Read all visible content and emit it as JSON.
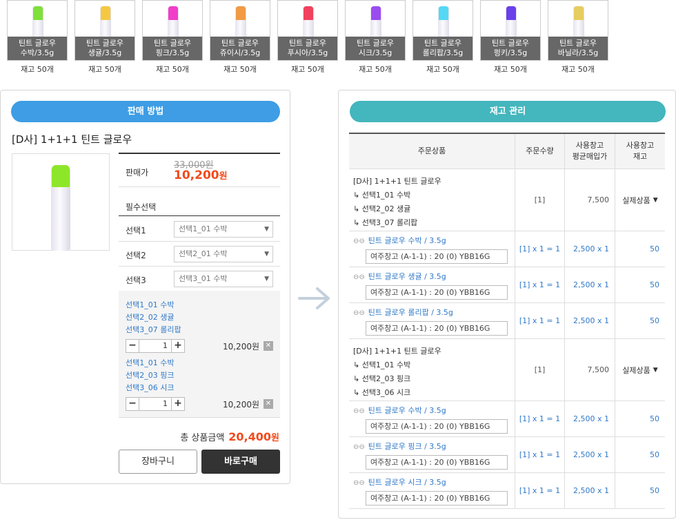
{
  "thumbs": [
    {
      "line1": "틴트 글로우",
      "line2": "수박/3.5g",
      "stock": "재고 50개",
      "cap": "#7fe03a"
    },
    {
      "line1": "틴트 글로우",
      "line2": "생귤/3.5g",
      "stock": "재고 50개",
      "cap": "#f5c842"
    },
    {
      "line1": "틴트 글로우",
      "line2": "핑크/3.5g",
      "stock": "재고 50개",
      "cap": "#f03ec9"
    },
    {
      "line1": "틴트 글로우",
      "line2": "쥬이시/3.5g",
      "stock": "재고 50개",
      "cap": "#f29a46"
    },
    {
      "line1": "틴트 글로우",
      "line2": "푸시아/3.5g",
      "stock": "재고 50개",
      "cap": "#f0425e"
    },
    {
      "line1": "틴트 글로우",
      "line2": "시크/3.5g",
      "stock": "재고 50개",
      "cap": "#9b4cf0"
    },
    {
      "line1": "틴트 글로우",
      "line2": "롤리팝/3.5g",
      "stock": "재고 50개",
      "cap": "#54d8f4"
    },
    {
      "line1": "틴트 글로우",
      "line2": "펑키/3.5g",
      "stock": "재고 50개",
      "cap": "#6a40ea"
    },
    {
      "line1": "틴트 글로우",
      "line2": "바닐라/3.5g",
      "stock": "재고 50개",
      "cap": "#e6cd60"
    }
  ],
  "sale": {
    "header": "판매 방법",
    "title": "[D사] 1+1+1 틴트 글로우",
    "price_label": "판매가",
    "old_price": "33,000원",
    "new_price": "10,200",
    "won": "원",
    "required_label": "필수선택",
    "selects": [
      {
        "label": "선택1",
        "value": "선택1_01 수박"
      },
      {
        "label": "선택2",
        "value": "선택2_01 수박"
      },
      {
        "label": "선택3",
        "value": "선택3_01 수박"
      }
    ],
    "cart": [
      {
        "l1": "선택1_01 수박",
        "l2": "선택2_02 생귤",
        "l3": "선택3_07 롤리팝",
        "qty": "1",
        "price": "10,200원"
      },
      {
        "l1": "선택1_01 수박",
        "l2": "선택2_03 핑크",
        "l3": "선택3_06 시크",
        "qty": "1",
        "price": "10,200원"
      }
    ],
    "total_label": "총 상품금액",
    "total_value": "20,400",
    "total_won": "원",
    "cart_button": "장바구니",
    "buy_button": "바로구매"
  },
  "stock": {
    "header": "재고 관리",
    "columns": {
      "product": "주문상품",
      "qty": "주문수량",
      "avg_line1": "사용창고",
      "avg_line2": "평균매입가",
      "stock_line1": "사용창고",
      "stock_line2": "재고"
    },
    "groups": [
      {
        "name": "[D사] 1+1+1 틴트 글로우",
        "opts": [
          "↳ 선택1_01 수박",
          "↳ 선택2_02 생귤",
          "↳ 선택3_07 롤리팝"
        ],
        "qty": "[1]",
        "avg": "7,500",
        "stock": "실제상품",
        "items": [
          {
            "name": "틴트 글로우 수박 / 3.5g",
            "wh": "여주창고 (A-1-1) : 20 (0) YBB16G",
            "qty": "[1] x 1 = 1",
            "avg": "2,500 x 1",
            "stock": "50"
          },
          {
            "name": "틴트 글로우 생귤 / 3.5g",
            "wh": "여주창고 (A-1-1) : 20 (0) YBB16G",
            "qty": "[1] x 1 = 1",
            "avg": "2,500 x 1",
            "stock": "50"
          },
          {
            "name": "틴트 글로우 롤리팝 / 3.5g",
            "wh": "여주창고 (A-1-1) : 20 (0) YBB16G",
            "qty": "[1] x 1 = 1",
            "avg": "2,500 x 1",
            "stock": "50"
          }
        ]
      },
      {
        "name": "[D사] 1+1+1 틴트 글로우",
        "opts": [
          "↳ 선택1_01 수박",
          "↳ 선택2_03 핑크",
          "↳ 선택3_06 시크"
        ],
        "qty": "[1]",
        "avg": "7,500",
        "stock": "실제상품",
        "items": [
          {
            "name": "틴트 글로우 수박 / 3.5g",
            "wh": "여주창고 (A-1-1) : 20 (0) YBB16G",
            "qty": "[1] x 1 = 1",
            "avg": "2,500 x 1",
            "stock": "50"
          },
          {
            "name": "틴트 글로우 핑크 / 3.5g",
            "wh": "여주창고 (A-1-1) : 20 (0) YBB16G",
            "qty": "[1] x 1 = 1",
            "avg": "2,500 x 1",
            "stock": "50"
          },
          {
            "name": "틴트 글로우 시크 / 3.5g",
            "wh": "여주창고 (A-1-1) : 20 (0) YBB16G",
            "qty": "[1] x 1 = 1",
            "avg": "2,500 x 1",
            "stock": "50"
          }
        ]
      }
    ]
  }
}
